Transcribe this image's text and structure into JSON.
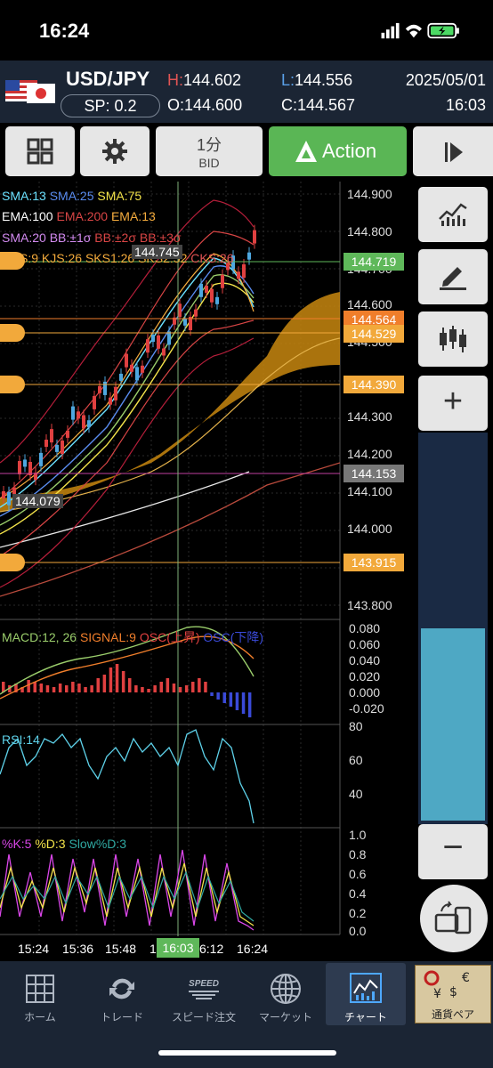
{
  "status": {
    "time": "16:24"
  },
  "header": {
    "pair": "USD/JPY",
    "spread": "SP: 0.2",
    "high_label": "H:",
    "high": "144.602",
    "low_label": "L:",
    "low": "144.556",
    "open_label": "O:",
    "open": "144.600",
    "close_label": "C:",
    "close": "144.567",
    "date": "2025/05/01",
    "time": "16:03"
  },
  "toolbar": {
    "timeframe": "1分",
    "price_type": "BID",
    "action_label": "Action"
  },
  "chart": {
    "indicators_line1": [
      "SMA:13",
      "SMA:25",
      "SMA:75"
    ],
    "indicators_line2": [
      "EMA:100",
      "EMA:200",
      "EMA:13"
    ],
    "indicators_line3": [
      "SMA:20",
      "BB:±1σ",
      "BB:±2σ",
      "BB:±3σ"
    ],
    "indicators_line4": [
      "S:9",
      "KJS:26",
      "SKS1:26",
      "SKS2:52",
      "CKS:26"
    ],
    "price_axis": [
      "144.900",
      "144.800",
      "144.700",
      "144.600",
      "144.500",
      "144.300",
      "144.200",
      "144.100",
      "144.000",
      "143.900",
      "143.800"
    ],
    "markers": {
      "high": "144.745",
      "low": "144.079",
      "crosshair_time": "16:03"
    },
    "tags": {
      "alert1": "144.719",
      "current": "144.564",
      "alert2": "144.529",
      "alert3": "144.390",
      "crosshair": "144.153",
      "alert4": "143.915"
    },
    "macd": {
      "label": "MACD:12, 26",
      "signal": "SIGNAL:9",
      "osc_up": "OSC(上昇)",
      "osc_down": "OSC(下降)",
      "axis": [
        "0.080",
        "0.060",
        "0.040",
        "0.020",
        "0.000",
        "-0.020"
      ]
    },
    "rsi": {
      "label": "RSI:14",
      "axis": [
        "80",
        "60",
        "40"
      ]
    },
    "stoch": {
      "k": "%K:5",
      "d": "%D:3",
      "slow": "Slow%D:3",
      "axis": [
        "1.0",
        "0.8",
        "0.6",
        "0.4",
        "0.2",
        "0.0"
      ]
    },
    "time_axis": [
      "15:24",
      "15:36",
      "15:48",
      "1",
      "6:12",
      "16:24"
    ]
  },
  "tabs": [
    "ホーム",
    "トレード",
    "スピード注文",
    "マーケット",
    "チャート",
    "通貨ペア"
  ],
  "colors": {
    "header_bg": "#1b2534",
    "action_green": "#5ab655",
    "alert_orange": "#f2a93b",
    "current_price": "#f07e2b",
    "high_green": "#5fb85a",
    "kumo": "#c8870f"
  }
}
